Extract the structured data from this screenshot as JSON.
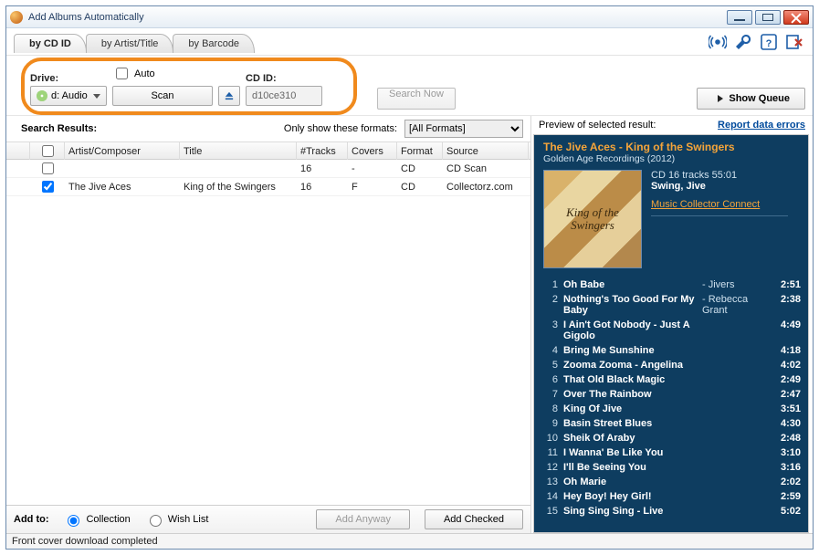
{
  "window": {
    "title": "Add Albums Automatically"
  },
  "tabs": [
    "by CD ID",
    "by Artist/Title",
    "by Barcode"
  ],
  "drive_label": "Drive:",
  "drive_value": "d: Audio",
  "auto_label": "Auto",
  "scan_label": "Scan",
  "cdid_label": "CD ID:",
  "cdid_value": "d10ce310",
  "search_now": "Search Now",
  "show_queue": "Show Queue",
  "formats_label": "Only show these formats:",
  "formats_value": "[All Formats]",
  "search_results_label": "Search Results:",
  "columns": [
    "",
    "",
    "Artist/Composer",
    "Title",
    "#Tracks",
    "Covers",
    "Format",
    "Source"
  ],
  "rows": [
    {
      "checked": false,
      "artist": "",
      "title": "",
      "tracks": "16",
      "covers": "-",
      "format": "CD",
      "source": "CD Scan"
    },
    {
      "checked": true,
      "artist": "The Jive Aces",
      "title": "King of the Swingers",
      "tracks": "16",
      "covers": "F",
      "format": "CD",
      "source": "Collectorz.com"
    }
  ],
  "add_to_label": "Add to:",
  "radio_collection": "Collection",
  "radio_wishlist": "Wish List",
  "add_anyway": "Add Anyway",
  "add_checked": "Add Checked",
  "preview_label": "Preview of selected result:",
  "report_link": "Report data errors",
  "album": {
    "title": "The Jive Aces - King of the Swingers",
    "subtitle": "Golden Age Recordings (2012)",
    "meta": "CD 16 tracks 55:01",
    "genres": "Swing, Jive",
    "connect": "Music Collector Connect",
    "cover_text": "King of the Swingers"
  },
  "tracklist": [
    {
      "n": 1,
      "title": "Oh Babe",
      "artist": "- Jivers",
      "dur": "2:51"
    },
    {
      "n": 2,
      "title": "Nothing's Too Good For My Baby",
      "artist": "- Rebecca Grant",
      "dur": "2:38"
    },
    {
      "n": 3,
      "title": "I Ain't Got Nobody - Just A Gigolo",
      "artist": "",
      "dur": "4:49"
    },
    {
      "n": 4,
      "title": "Bring Me Sunshine",
      "artist": "",
      "dur": "4:18"
    },
    {
      "n": 5,
      "title": "Zooma Zooma - Angelina",
      "artist": "",
      "dur": "4:02"
    },
    {
      "n": 6,
      "title": "That Old Black Magic",
      "artist": "",
      "dur": "2:49"
    },
    {
      "n": 7,
      "title": "Over The Rainbow",
      "artist": "",
      "dur": "2:47"
    },
    {
      "n": 8,
      "title": "King Of Jive",
      "artist": "",
      "dur": "3:51"
    },
    {
      "n": 9,
      "title": "Basin Street Blues",
      "artist": "",
      "dur": "4:30"
    },
    {
      "n": 10,
      "title": "Sheik Of Araby",
      "artist": "",
      "dur": "2:48"
    },
    {
      "n": 11,
      "title": "I Wanna' Be Like You",
      "artist": "",
      "dur": "3:10"
    },
    {
      "n": 12,
      "title": "I'll Be Seeing You",
      "artist": "",
      "dur": "3:16"
    },
    {
      "n": 13,
      "title": "Oh Marie",
      "artist": "",
      "dur": "2:02"
    },
    {
      "n": 14,
      "title": "Hey Boy! Hey Girl!",
      "artist": "",
      "dur": "2:59"
    },
    {
      "n": 15,
      "title": "Sing Sing Sing - Live",
      "artist": "",
      "dur": "5:02"
    }
  ],
  "status": "Front cover download completed"
}
